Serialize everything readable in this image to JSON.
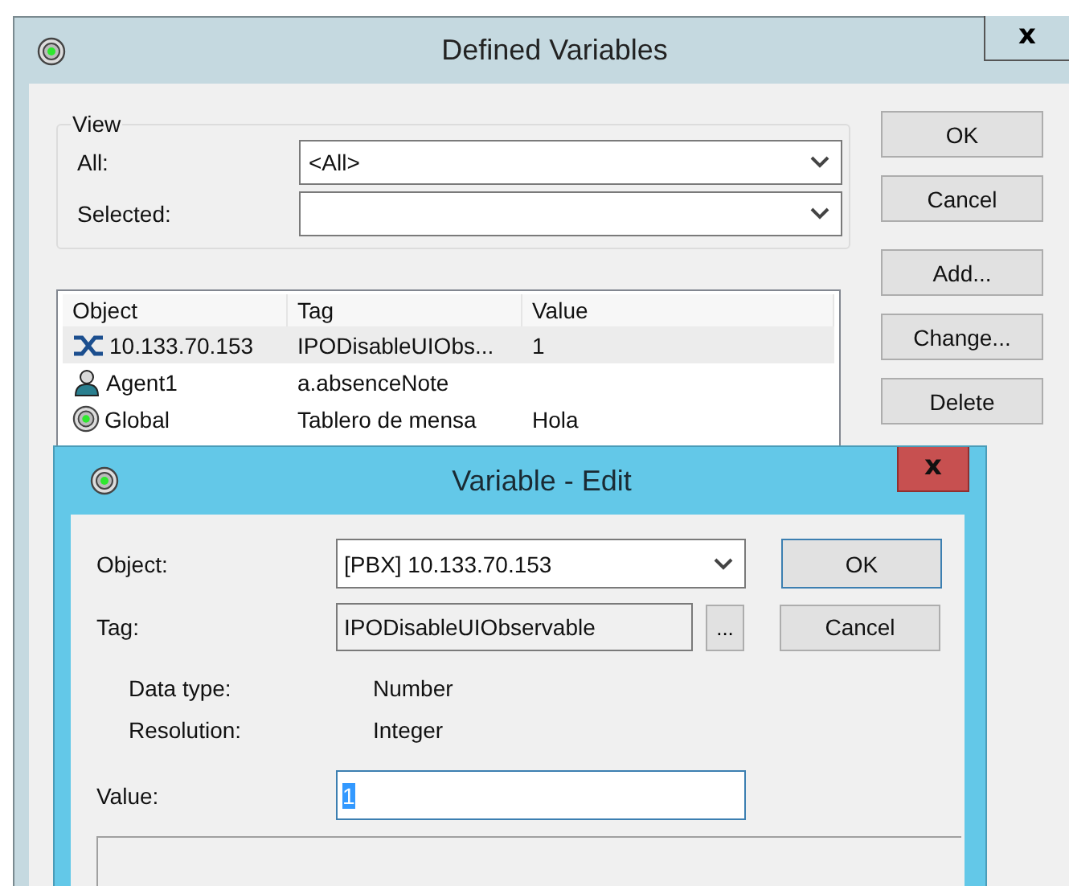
{
  "window": {
    "title": "Defined Variables",
    "close": "x"
  },
  "view": {
    "legend": "View",
    "fields": [
      {
        "label": "All:",
        "value": "<All>"
      },
      {
        "label": "Selected:"
      }
    ]
  },
  "table": {
    "columns": [
      "Object",
      "Tag",
      "Value"
    ],
    "rows": [
      {
        "kind": "pbx",
        "object": "10.133.70.153",
        "tag": "IPODisableUIObs...",
        "value": "1",
        "selected": true
      },
      {
        "kind": "agent",
        "object": "Agent1",
        "tag": "a.absenceNote",
        "selected": false
      },
      {
        "kind": "global",
        "object": "Global",
        "tag": "Tablero de mensa",
        "value": "Hola",
        "selected": false
      }
    ]
  },
  "buttons": [
    "OK",
    "Cancel",
    "Add...",
    "Change...",
    "Delete"
  ],
  "dialog": {
    "title": "Variable - Edit",
    "close": "x",
    "object": {
      "label": "Object:",
      "value": "[PBX] 10.133.70.153"
    },
    "tag": {
      "label": "Tag:",
      "value": "IPODisableUIObservable",
      "browse": "..."
    },
    "info": [
      {
        "label": "Data type:",
        "value": "Number"
      },
      {
        "label": "Resolution:",
        "value": "Integer"
      }
    ],
    "value": {
      "label": "Value:",
      "value": "1",
      "selected": true
    },
    "buttons": [
      {
        "label": "OK",
        "default": true
      },
      {
        "label": "Cancel",
        "default": false
      }
    ]
  }
}
